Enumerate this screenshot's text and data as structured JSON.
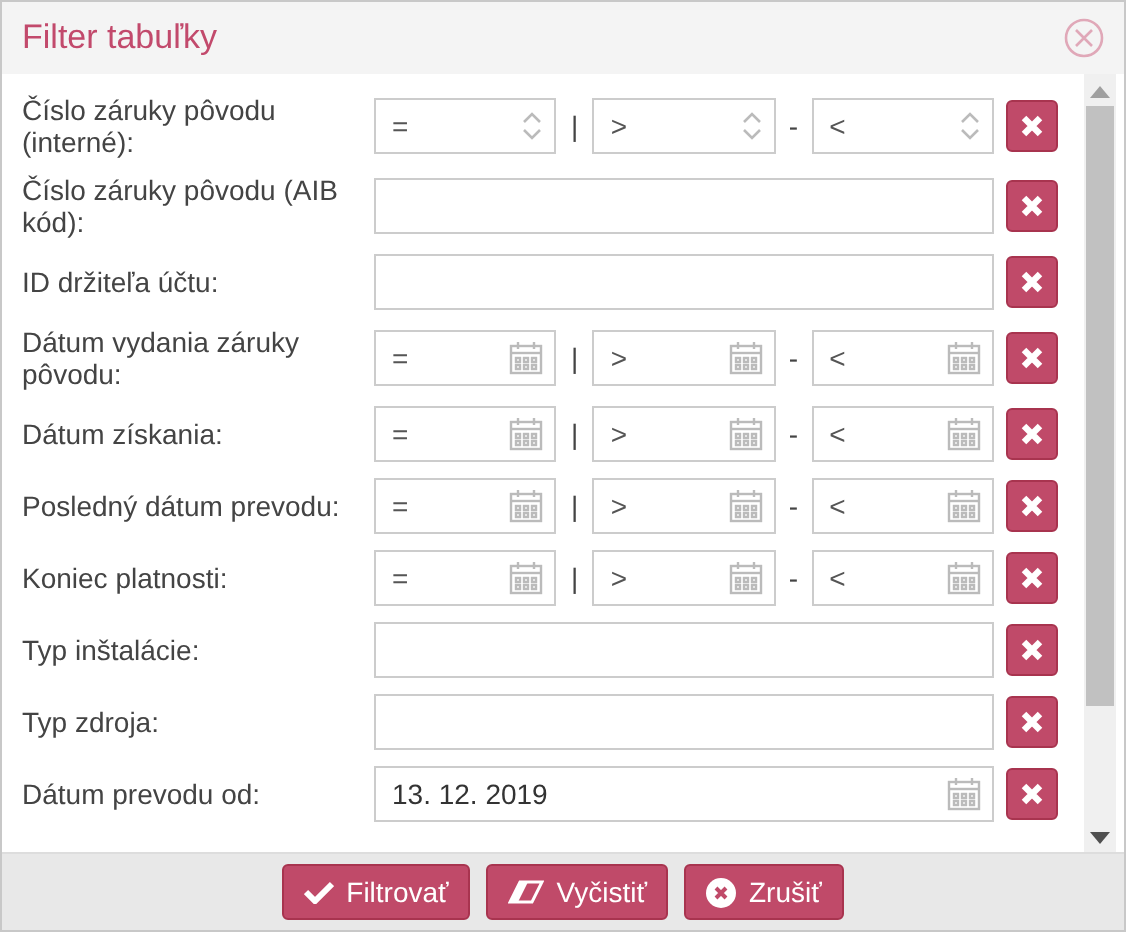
{
  "dialog": {
    "title": "Filter tabuľky"
  },
  "rows": [
    {
      "kind": "number-range",
      "label": "Číslo záruky pôvodu (interné):",
      "fields": [
        {
          "placeholder": "="
        },
        {
          "placeholder": ">"
        },
        {
          "placeholder": "<"
        }
      ],
      "separators": [
        "|",
        "-"
      ]
    },
    {
      "kind": "text",
      "label": "Číslo záruky pôvodu (AIB kód):"
    },
    {
      "kind": "text",
      "label": "ID držiteľa účtu:"
    },
    {
      "kind": "date-range",
      "label": "Dátum vydania záruky pôvodu:",
      "fields": [
        {
          "placeholder": "="
        },
        {
          "placeholder": ">"
        },
        {
          "placeholder": "<"
        }
      ],
      "separators": [
        "|",
        "-"
      ]
    },
    {
      "kind": "date-range",
      "label": "Dátum získania:",
      "fields": [
        {
          "placeholder": "="
        },
        {
          "placeholder": ">"
        },
        {
          "placeholder": "<"
        }
      ],
      "separators": [
        "|",
        "-"
      ]
    },
    {
      "kind": "date-range",
      "label": "Posledný dátum prevodu:",
      "fields": [
        {
          "placeholder": "="
        },
        {
          "placeholder": ">"
        },
        {
          "placeholder": "<"
        }
      ],
      "separators": [
        "|",
        "-"
      ]
    },
    {
      "kind": "date-range",
      "label": "Koniec platnosti:",
      "fields": [
        {
          "placeholder": "="
        },
        {
          "placeholder": ">"
        },
        {
          "placeholder": "<"
        }
      ],
      "separators": [
        "|",
        "-"
      ]
    },
    {
      "kind": "text",
      "label": "Typ inštalácie:"
    },
    {
      "kind": "text",
      "label": "Typ zdroja:"
    },
    {
      "kind": "date",
      "label": "Dátum prevodu od:",
      "value": "13. 12. 2019"
    }
  ],
  "buttons": [
    {
      "kind": "filter",
      "label": "Filtrovať"
    },
    {
      "kind": "clear",
      "label": "Vyčistiť"
    },
    {
      "kind": "cancel",
      "label": "Zrušiť"
    }
  ]
}
